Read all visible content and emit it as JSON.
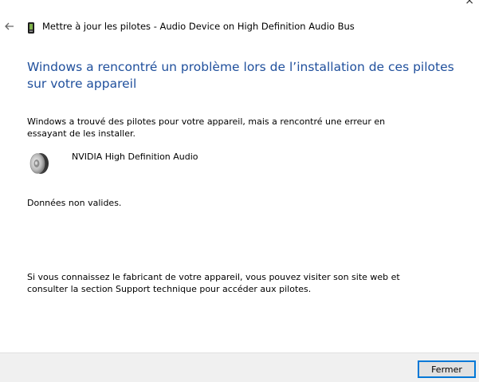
{
  "window": {
    "close_glyph": "×"
  },
  "titlebar": {
    "back_icon": "back-arrow-icon",
    "title": "Mettre à jour les pilotes - Audio Device on High Definition Audio Bus"
  },
  "content": {
    "heading": "Windows a rencontré un problème lors de l’installation de ces pilotes sur votre appareil",
    "description": "Windows a trouvé des pilotes pour votre appareil, mais a rencontré une erreur en essayant de les installer.",
    "device": {
      "icon": "speaker-icon",
      "name": "NVIDIA High Definition Audio"
    },
    "error_message": "Données non valides.",
    "support_text": "Si vous connaissez le fabricant de votre appareil, vous pouvez visiter son site web et consulter la section Support technique pour accéder aux pilotes."
  },
  "footer": {
    "close_label": "Fermer"
  },
  "colors": {
    "heading": "#1f4f9c",
    "accent": "#0078d7",
    "footer_bg": "#f0f0f0"
  }
}
